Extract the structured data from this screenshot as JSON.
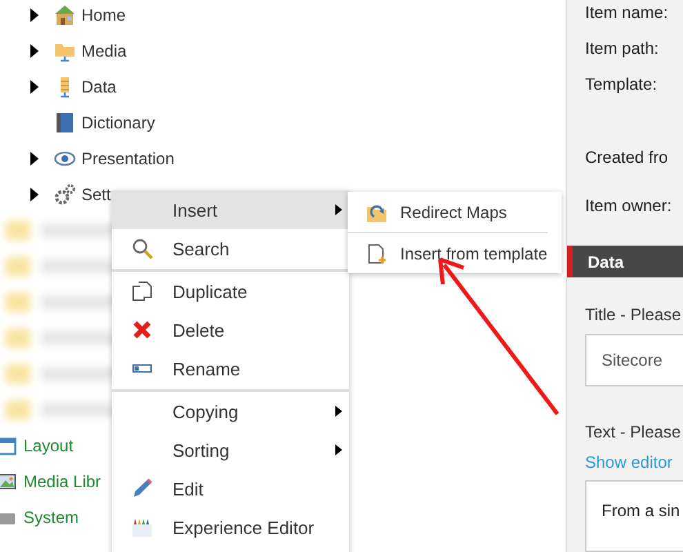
{
  "tree": {
    "items": [
      {
        "label": "Home",
        "kind": "home",
        "expandable": true
      },
      {
        "label": "Media",
        "kind": "media",
        "expandable": true
      },
      {
        "label": "Data",
        "kind": "data",
        "expandable": true
      },
      {
        "label": "Dictionary",
        "kind": "book",
        "expandable": false
      },
      {
        "label": "Presentation",
        "kind": "eye",
        "expandable": true
      },
      {
        "label": "Sett",
        "kind": "gear",
        "expandable": true
      }
    ],
    "roots": [
      {
        "label": "Layout",
        "kind": "layout"
      },
      {
        "label": "Media Libr",
        "kind": "picture"
      },
      {
        "label": "System",
        "kind": "system"
      }
    ]
  },
  "context_menu": {
    "items": [
      {
        "label": "Insert",
        "kind": "plain",
        "submenu": true,
        "selected": true,
        "separator_before": false
      },
      {
        "label": "Search",
        "kind": "search",
        "submenu": false,
        "selected": false,
        "separator_before": false
      },
      {
        "label": "Duplicate",
        "kind": "duplicate",
        "submenu": false,
        "selected": false,
        "separator_before": true
      },
      {
        "label": "Delete",
        "kind": "delete",
        "submenu": false,
        "selected": false,
        "separator_before": false
      },
      {
        "label": "Rename",
        "kind": "rename",
        "submenu": false,
        "selected": false,
        "separator_before": false
      },
      {
        "label": "Copying",
        "kind": "plain",
        "submenu": true,
        "selected": false,
        "separator_before": true
      },
      {
        "label": "Sorting",
        "kind": "plain",
        "submenu": true,
        "selected": false,
        "separator_before": false
      },
      {
        "label": "Edit",
        "kind": "pencil",
        "submenu": false,
        "selected": false,
        "separator_before": false
      },
      {
        "label": "Experience Editor",
        "kind": "crayons",
        "submenu": false,
        "selected": false,
        "separator_before": false
      }
    ]
  },
  "submenu": {
    "items": [
      {
        "label": "Redirect Maps",
        "kind": "folder"
      },
      {
        "label": "Insert from template",
        "kind": "page"
      }
    ]
  },
  "details": {
    "fields": [
      "Item name:",
      "Item path:",
      "Template:",
      "Created fro",
      "Item owner:"
    ],
    "section": "Data",
    "title_label": "Title - Please",
    "title_value": "Sitecore",
    "text_label": "Text - Please",
    "show_editor": "Show editor",
    "text_value": "From a sin"
  }
}
